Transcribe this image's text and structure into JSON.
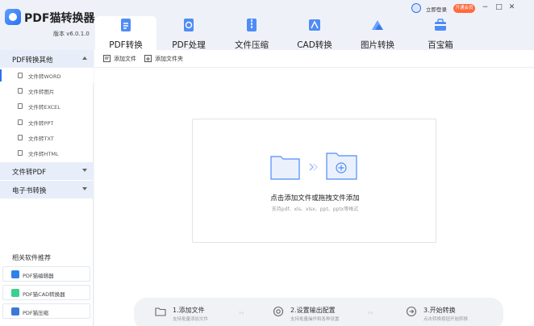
{
  "app": {
    "title": "PDF猫转换器",
    "version": "版本 v6.0.1.0"
  },
  "account": {
    "login_label": "立即登录",
    "vip_label": "开通会员"
  },
  "window_controls": {
    "minimize": "−",
    "maximize": "□",
    "close": "✕"
  },
  "tabs": [
    {
      "label": "PDF转换",
      "icon": "pdf-convert-icon"
    },
    {
      "label": "PDF处理",
      "icon": "pdf-process-icon"
    },
    {
      "label": "文件压缩",
      "icon": "file-compress-icon"
    },
    {
      "label": "CAD转换",
      "icon": "cad-convert-icon"
    },
    {
      "label": "图片转换",
      "icon": "image-convert-icon"
    },
    {
      "label": "百宝箱",
      "icon": "toolbox-icon"
    }
  ],
  "sidebar": {
    "sections": [
      {
        "label": "PDF转换其他",
        "expanded": true
      },
      {
        "label": "文件转PDF",
        "expanded": false
      },
      {
        "label": "电子书转换",
        "expanded": false
      }
    ],
    "items": [
      {
        "label": "文件转WORD",
        "active": true
      },
      {
        "label": "文件转图片"
      },
      {
        "label": "文件转EXCEL"
      },
      {
        "label": "文件转PPT"
      },
      {
        "label": "文件转TXT"
      },
      {
        "label": "文件转HTML"
      }
    ],
    "recommend_title": "相关软件推荐",
    "recommend": [
      {
        "label": "PDF猫编辑器",
        "color": "#2f80ed"
      },
      {
        "label": "PDF猫CAD转换器",
        "color": "#3ccf8e"
      },
      {
        "label": "PDF猫压缩",
        "color": "#3a7bd5"
      }
    ]
  },
  "toolbar": {
    "add_file": "添加文件",
    "add_folder": "添加文件夹"
  },
  "dropzone": {
    "main_text": "点击添加文件或拖拽文件添加",
    "sub_text": "支持pdf、xls、xlsx、ppt、pptx等格式"
  },
  "steps": [
    {
      "title": "1.添加文件",
      "desc": "支持批量添加文件"
    },
    {
      "title": "2.设置输出配置",
      "desc": "支持批量操作和各种设置"
    },
    {
      "title": "3.开始转换",
      "desc": "点击转换按钮开始转换"
    }
  ],
  "colors": {
    "accent": "#2f6ff0",
    "sidebar_section_bg": "#e8eef9",
    "topbar_bg": "#eef2f8",
    "vip": "#ff6a3d"
  }
}
